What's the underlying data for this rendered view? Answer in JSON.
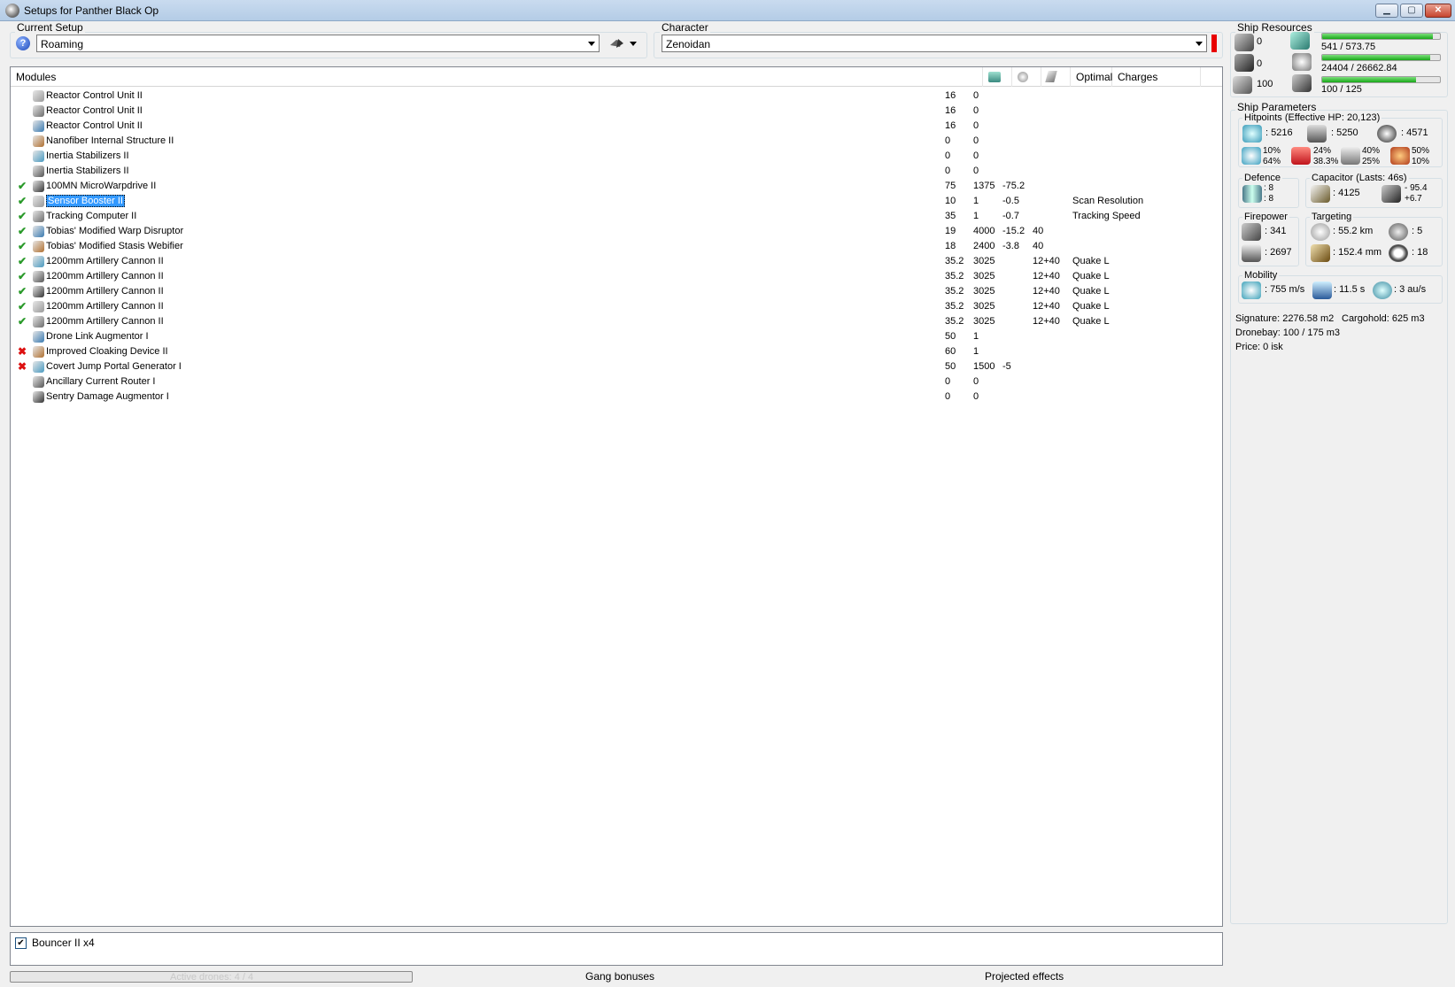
{
  "window": {
    "title": "Setups for Panther Black Op",
    "controls": [
      "minimize",
      "maximize",
      "close"
    ]
  },
  "setup": {
    "label": "Current Setup",
    "value": "Roaming"
  },
  "character": {
    "label": "Character",
    "value": "Zenoidan"
  },
  "modules": {
    "columns": [
      "Modules",
      "Optimal",
      "Charges"
    ],
    "rows": [
      {
        "status": "",
        "name": "Reactor Control Unit II",
        "cpu": "16",
        "pg": "0",
        "cap": "",
        "optimal": "",
        "charges": ""
      },
      {
        "status": "",
        "name": "Reactor Control Unit II",
        "cpu": "16",
        "pg": "0",
        "cap": "",
        "optimal": "",
        "charges": ""
      },
      {
        "status": "",
        "name": "Reactor Control Unit II",
        "cpu": "16",
        "pg": "0",
        "cap": "",
        "optimal": "",
        "charges": ""
      },
      {
        "status": "",
        "name": "Nanofiber Internal Structure II",
        "cpu": "0",
        "pg": "0",
        "cap": "",
        "optimal": "",
        "charges": ""
      },
      {
        "status": "",
        "name": "Inertia Stabilizers II",
        "cpu": "0",
        "pg": "0",
        "cap": "",
        "optimal": "",
        "charges": ""
      },
      {
        "status": "",
        "name": "Inertia Stabilizers II",
        "cpu": "0",
        "pg": "0",
        "cap": "",
        "optimal": "",
        "charges": ""
      },
      {
        "status": "✔",
        "name": "100MN MicroWarpdrive II",
        "cpu": "75",
        "pg": "1375",
        "cap": "-75.2",
        "optimal": "",
        "charges": ""
      },
      {
        "status": "✔",
        "name": "Sensor Booster II",
        "cpu": "10",
        "pg": "1",
        "cap": "-0.5",
        "optimal": "",
        "charges": "Scan Resolution"
      },
      {
        "status": "✔",
        "name": "Tracking Computer II",
        "cpu": "35",
        "pg": "1",
        "cap": "-0.7",
        "optimal": "",
        "charges": "Tracking Speed"
      },
      {
        "status": "✔",
        "name": "Tobias' Modified Warp Disruptor",
        "cpu": "19",
        "pg": "4000",
        "cap": "-15.2",
        "optimal": "40",
        "charges": ""
      },
      {
        "status": "✔",
        "name": "Tobias' Modified Stasis Webifier",
        "cpu": "18",
        "pg": "2400",
        "cap": "-3.8",
        "optimal": "40",
        "charges": ""
      },
      {
        "status": "✔",
        "name": "1200mm Artillery Cannon II",
        "cpu": "35.2",
        "pg": "3025",
        "cap": "",
        "optimal": "12+40",
        "charges": "Quake L"
      },
      {
        "status": "✔",
        "name": "1200mm Artillery Cannon II",
        "cpu": "35.2",
        "pg": "3025",
        "cap": "",
        "optimal": "12+40",
        "charges": "Quake L"
      },
      {
        "status": "✔",
        "name": "1200mm Artillery Cannon II",
        "cpu": "35.2",
        "pg": "3025",
        "cap": "",
        "optimal": "12+40",
        "charges": "Quake L"
      },
      {
        "status": "✔",
        "name": "1200mm Artillery Cannon II",
        "cpu": "35.2",
        "pg": "3025",
        "cap": "",
        "optimal": "12+40",
        "charges": "Quake L"
      },
      {
        "status": "✔",
        "name": "1200mm Artillery Cannon II",
        "cpu": "35.2",
        "pg": "3025",
        "cap": "",
        "optimal": "12+40",
        "charges": "Quake L"
      },
      {
        "status": "",
        "name": "Drone Link Augmentor I",
        "cpu": "50",
        "pg": "1",
        "cap": "",
        "optimal": "",
        "charges": ""
      },
      {
        "status": "✖",
        "name": "Improved Cloaking Device II",
        "cpu": "60",
        "pg": "1",
        "cap": "",
        "optimal": "",
        "charges": ""
      },
      {
        "status": "✖",
        "name": "Covert Jump Portal Generator I",
        "cpu": "50",
        "pg": "1500",
        "cap": "-5",
        "optimal": "",
        "charges": ""
      },
      {
        "status": "",
        "name": "Ancillary Current Router I",
        "cpu": "0",
        "pg": "0",
        "cap": "",
        "optimal": "",
        "charges": ""
      },
      {
        "status": "",
        "name": "Sentry Damage Augmentor I",
        "cpu": "0",
        "pg": "0",
        "cap": "",
        "optimal": "",
        "charges": ""
      }
    ]
  },
  "drones": {
    "item": "Bouncer II x4",
    "checked": true
  },
  "bottom": {
    "active_drones": "Active drones: 4 / 4",
    "gang": "Gang bonuses",
    "projected": "Projected effects"
  },
  "resources": {
    "label": "Ship Resources",
    "turret": "0",
    "launcher": "0",
    "calibration": "100",
    "cpu": "541 / 573.75",
    "cpu_frac": 0.943,
    "pg": "24404 / 26662.84",
    "pg_frac": 0.915,
    "drone_bw": "100 / 125",
    "drone_bw_frac": 0.8
  },
  "params": {
    "label": "Ship Parameters",
    "hp_label": "Hitpoints (Effective HP: 20,123)",
    "shield_hp": ": 5216",
    "armor_hp": ": 5250",
    "structure_hp": ": 4571",
    "em": [
      "10%",
      "64%"
    ],
    "thermal": [
      "24%",
      "38.3%"
    ],
    "kinetic": [
      "40%",
      "25%"
    ],
    "explosive": [
      "50%",
      "10%"
    ],
    "defence_label": "Defence",
    "defence": [
      ": 8",
      ": 8"
    ],
    "capacitor_label": "Capacitor (Lasts: 46s)",
    "cap_amount": ": 4125",
    "cap_delta": [
      "- 95.4",
      "+6.7"
    ],
    "firepower_label": "Firepower",
    "firepower": [
      ": 341",
      ": 2697"
    ],
    "targeting_label": "Targeting",
    "target_range": ": 55.2 km",
    "max_targets": ": 5",
    "scan_res": ": 152.4 mm",
    "sensor_str": ": 18",
    "mobility_label": "Mobility",
    "speed": ": 755 m/s",
    "align": ": 11.5 s",
    "warp": ": 3 au/s",
    "signature": "Signature: 2276.58 m2",
    "cargohold": "Cargohold: 625 m3",
    "dronebay": "Dronebay: 100 / 175 m3",
    "price": "Price: 0 isk"
  }
}
